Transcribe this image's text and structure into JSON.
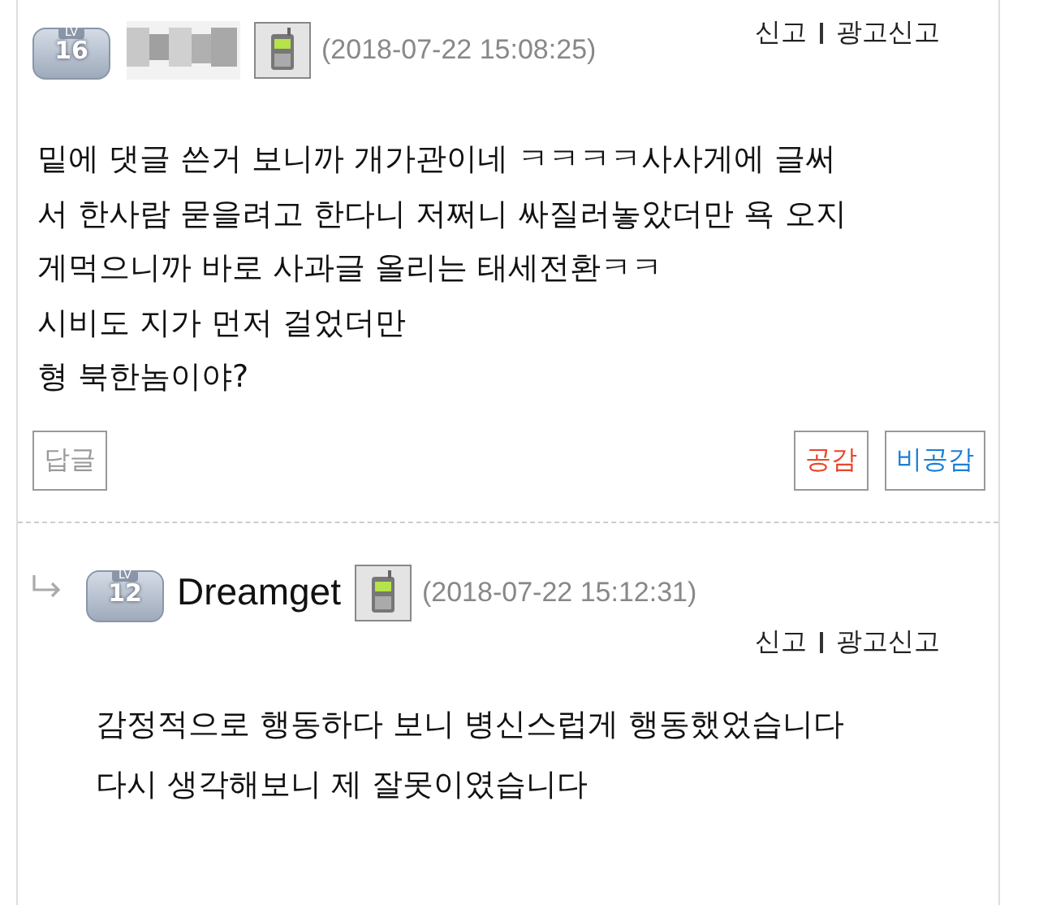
{
  "comment": {
    "level": "16",
    "level_prefix": "LV",
    "timestamp": "(2018-07-22 15:08:25)",
    "actions": [
      "신고",
      "광고신고"
    ],
    "lines": [
      "밑에 댓글 쓴거 보니까 개가관이네 ㅋㅋㅋㅋ사사게에 글써",
      "서 한사람 묻을려고 한다니 저쩌니 싸질러놓았더만 욕 오지",
      "게먹으니까 바로 사과글 올리는 태세전환ㅋㅋ",
      "시비도 지가 먼저 걸었더만",
      "형 북한놈이야?"
    ],
    "reply_button": "답글",
    "like_button": "공감",
    "dislike_button": "비공감"
  },
  "reply": {
    "level": "12",
    "level_prefix": "LV",
    "author": "Dreamget",
    "timestamp": "(2018-07-22 15:12:31)",
    "actions": [
      "신고",
      "광고신고"
    ],
    "lines": [
      "감정적으로 행동하다 보니 병신스럽게 행동했었습니다",
      "다시 생각해보니 제 잘못이였습니다"
    ]
  }
}
